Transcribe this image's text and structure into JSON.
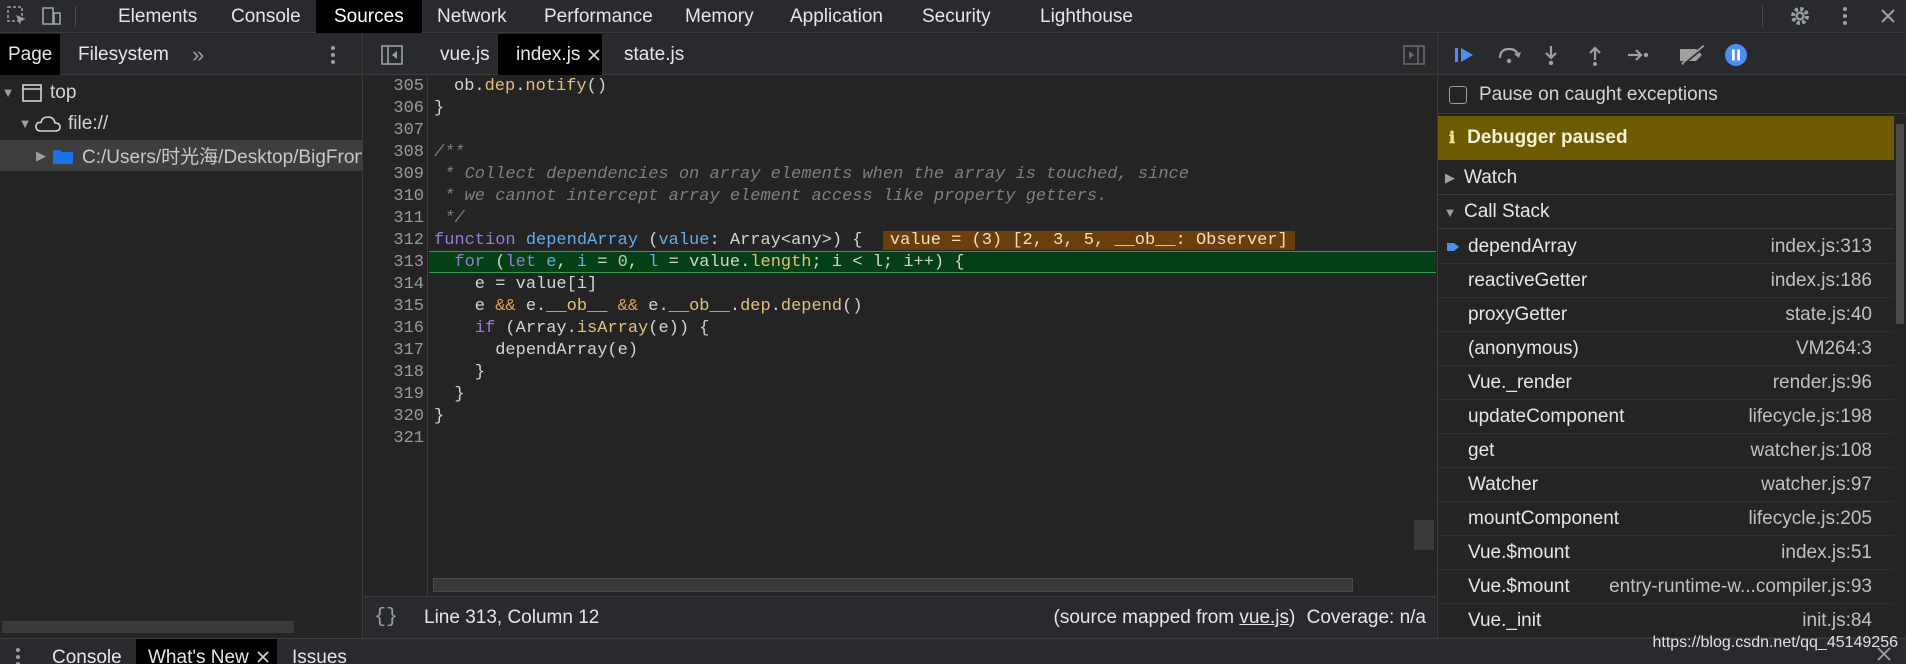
{
  "top_tabs": [
    {
      "label": "Elements",
      "active": false
    },
    {
      "label": "Console",
      "active": false
    },
    {
      "label": "Sources",
      "active": true
    },
    {
      "label": "Network",
      "active": false
    },
    {
      "label": "Performance",
      "active": false
    },
    {
      "label": "Memory",
      "active": false
    },
    {
      "label": "Application",
      "active": false
    },
    {
      "label": "Security",
      "active": false
    },
    {
      "label": "Lighthouse",
      "active": false
    }
  ],
  "navigator": {
    "tabs": [
      {
        "label": "Page",
        "active": true
      },
      {
        "label": "Filesystem",
        "active": false
      }
    ],
    "more": "»",
    "tree": [
      {
        "label": "top",
        "icon": "frame-icon",
        "expanded": true
      },
      {
        "label": "file://",
        "icon": "cloud-icon",
        "expanded": true
      },
      {
        "label": "C:/Users/时光海/Desktop/BigFron",
        "icon": "folder-icon",
        "expanded": false,
        "selected": true
      }
    ]
  },
  "editor": {
    "tabs": [
      {
        "label": "vue.js",
        "active": false
      },
      {
        "label": "index.js",
        "active": true,
        "closable": true
      },
      {
        "label": "state.js",
        "active": false
      }
    ],
    "current_line": 313,
    "inline_value": "value = (3) [2, 3, 5, __ob__: Observer]",
    "status": {
      "position": "Line 313, Column 12",
      "source_prefix": "(source mapped from ",
      "source_link": "vue.js",
      "source_suffix": ")",
      "coverage": "Coverage: n/a",
      "format_button": "{}"
    }
  },
  "debugger": {
    "pause_on_caught": {
      "label": "Pause on caught exceptions",
      "checked": false
    },
    "paused_banner": "Debugger paused",
    "info_icon": "ℹ",
    "sections": {
      "watch": "Watch",
      "call_stack": "Call Stack"
    },
    "call_stack": [
      {
        "name": "dependArray",
        "location": "index.js:313",
        "current": true
      },
      {
        "name": "reactiveGetter",
        "location": "index.js:186"
      },
      {
        "name": "proxyGetter",
        "location": "state.js:40"
      },
      {
        "name": "(anonymous)",
        "location": "VM264:3"
      },
      {
        "name": "Vue._render",
        "location": "render.js:96"
      },
      {
        "name": "updateComponent",
        "location": "lifecycle.js:198"
      },
      {
        "name": "get",
        "location": "watcher.js:108"
      },
      {
        "name": "Watcher",
        "location": "watcher.js:97"
      },
      {
        "name": "mountComponent",
        "location": "lifecycle.js:205"
      },
      {
        "name": "Vue.$mount",
        "location": "index.js:51"
      },
      {
        "name": "Vue.$mount",
        "location": "entry-runtime-w...compiler.js:93"
      },
      {
        "name": "Vue._init",
        "location": "init.js:84"
      }
    ]
  },
  "drawer": {
    "tabs": [
      {
        "label": "Console",
        "active": false
      },
      {
        "label": "What's New",
        "active": true,
        "closable": true
      },
      {
        "label": "Issues",
        "active": false
      }
    ]
  },
  "watermark": "https://blog.csdn.net/qq_45149256",
  "colors": {
    "background": "#242424",
    "execution_line": "#043f16",
    "paused_banner": "#6e5a00",
    "accent_blue": "#4c8df6",
    "inline_value_bg": "#6b3e0b"
  }
}
